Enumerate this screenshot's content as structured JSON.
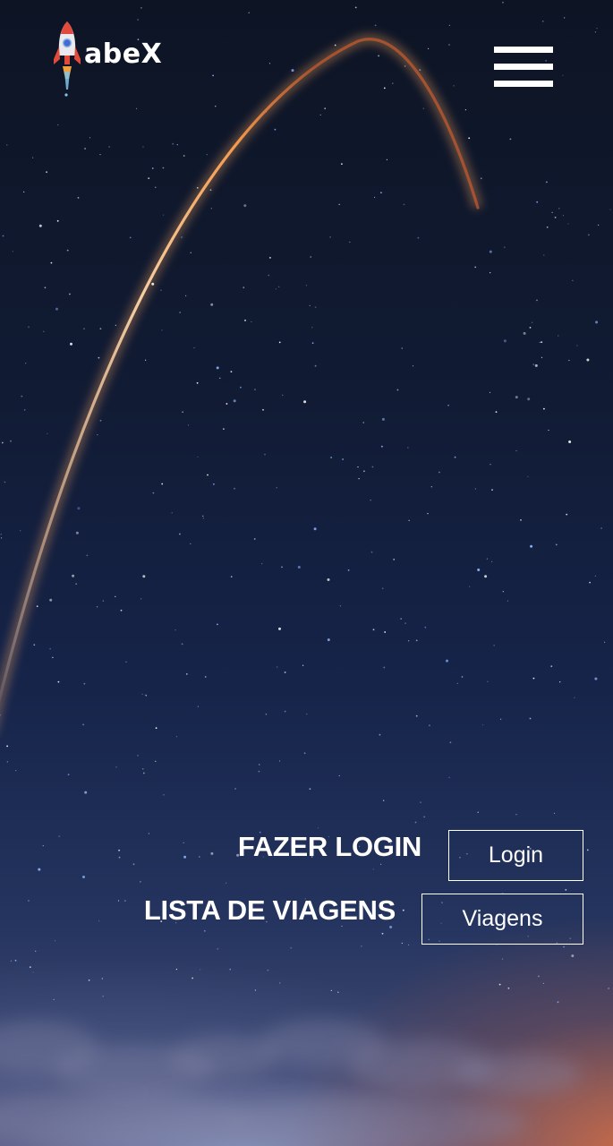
{
  "header": {
    "logo_text": "abeX",
    "logo_icon": "rocket-icon",
    "menu_icon": "hamburger-menu-icon"
  },
  "actions": [
    {
      "label": "FAZER LOGIN",
      "button_label": "Login"
    },
    {
      "label": "LISTA DE VIAGENS",
      "button_label": "Viagens"
    }
  ],
  "colors": {
    "text": "#ffffff",
    "sky_top": "#0d1424",
    "sky_bottom": "#58557a",
    "horizon_glow": "#d66c40",
    "rocket_trail": "#f3a35a"
  }
}
